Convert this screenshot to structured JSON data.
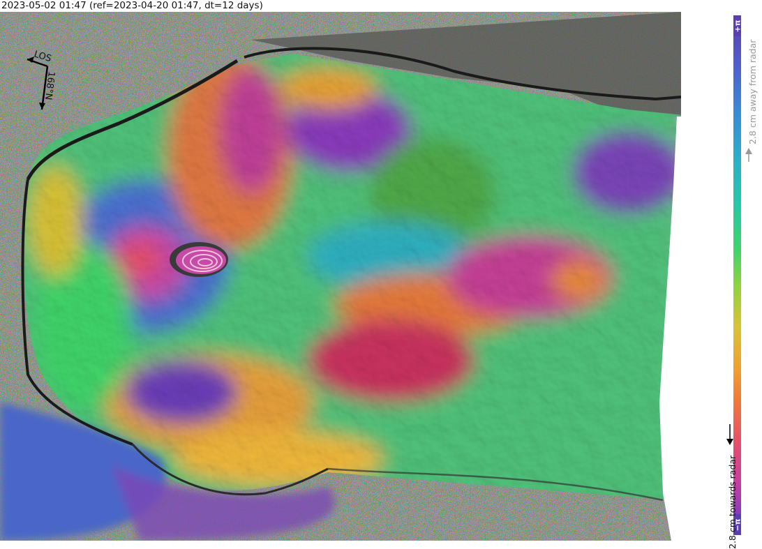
{
  "header": {
    "title": "2023-05-02 01:47 (ref=2023-04-20 01:47, dt=12 days)"
  },
  "map": {
    "los_label": "LOS",
    "heading_label": "168°N"
  },
  "colorbar": {
    "top_label": "+π",
    "bottom_label": "−π",
    "away_label": "2.8 cm away from radar",
    "towards_label": "2.8 cm towards radar",
    "colors": {
      "pi": "#5b3fb0",
      "away_text": "#999999",
      "towards_text": "#111111"
    }
  }
}
